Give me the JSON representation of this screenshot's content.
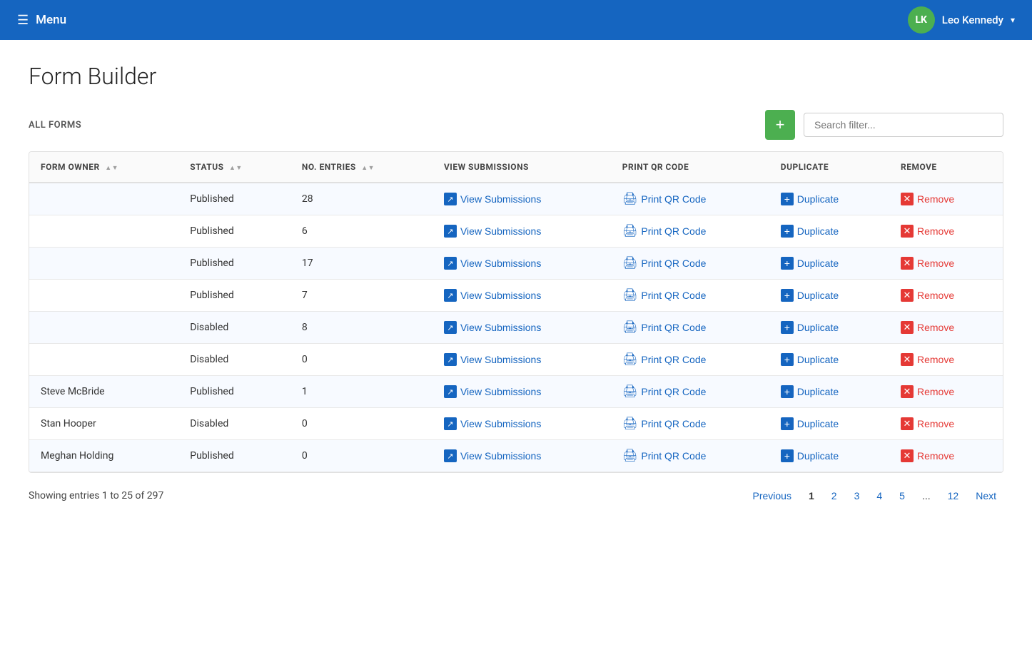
{
  "header": {
    "menu_label": "Menu",
    "user_initials": "LK",
    "user_name": "Leo Kennedy",
    "dropdown_arrow": "▾"
  },
  "page": {
    "title": "Form Builder",
    "all_forms_label": "ALL FORMS",
    "add_button_label": "+",
    "search_placeholder": "Search filter..."
  },
  "table": {
    "columns": [
      {
        "id": "form_owner",
        "label": "FORM OWNER"
      },
      {
        "id": "status",
        "label": "STATUS"
      },
      {
        "id": "no_entries",
        "label": "NO. ENTRIES"
      },
      {
        "id": "view_submissions",
        "label": "VIEW SUBMISSIONS"
      },
      {
        "id": "print_qr_code",
        "label": "PRINT QR CODE"
      },
      {
        "id": "duplicate",
        "label": "DUPLICATE"
      },
      {
        "id": "remove",
        "label": "REMOVE"
      }
    ],
    "rows": [
      {
        "form_owner": "",
        "status": "Published",
        "no_entries": "28",
        "status_class": "status-published"
      },
      {
        "form_owner": "",
        "status": "Published",
        "no_entries": "6",
        "status_class": "status-published"
      },
      {
        "form_owner": "",
        "status": "Published",
        "no_entries": "17",
        "status_class": "status-published"
      },
      {
        "form_owner": "",
        "status": "Published",
        "no_entries": "7",
        "status_class": "status-published"
      },
      {
        "form_owner": "",
        "status": "Disabled",
        "no_entries": "8",
        "status_class": "status-disabled"
      },
      {
        "form_owner": "",
        "status": "Disabled",
        "no_entries": "0",
        "status_class": "status-disabled"
      },
      {
        "form_owner": "Steve McBride",
        "status": "Published",
        "no_entries": "1",
        "status_class": "status-published"
      },
      {
        "form_owner": "Stan Hooper",
        "status": "Disabled",
        "no_entries": "0",
        "status_class": "status-disabled"
      },
      {
        "form_owner": "Meghan Holding",
        "status": "Published",
        "no_entries": "0",
        "status_class": "status-published"
      }
    ],
    "action_labels": {
      "view_submissions": "View Submissions",
      "print_qr_code": "Print QR Code",
      "duplicate": "Duplicate",
      "remove": "Remove"
    }
  },
  "pagination": {
    "summary": "Showing entries 1 to 25 of 297",
    "previous": "Previous",
    "next": "Next",
    "pages": [
      "1",
      "2",
      "3",
      "4",
      "5",
      "...",
      "12"
    ],
    "current_page": "1"
  }
}
